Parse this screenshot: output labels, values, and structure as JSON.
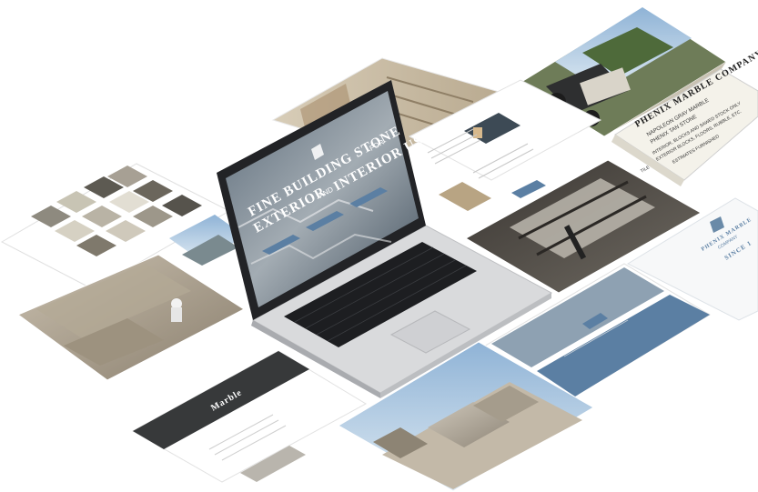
{
  "laptop": {
    "screen": {
      "headline_line1": "FINE BUILDING STONE",
      "headline_for": "FOR",
      "headline_line2": "EXTERIOR",
      "headline_and": "AND",
      "headline_line3": "INTERIOR USE"
    }
  },
  "cards": {
    "newspaper": {
      "title": "PHENIX MARBLE COMPANY",
      "line1": "NAPOLEON GRAY MARBLE",
      "line2": "PHENIX TAN STONE",
      "line3": "INTERIOR, BLOCKS AND SAWED STOCK ONLY",
      "line4": "EXTERIOR BLOCKS, FLOORS, RUBBLE, ETC.",
      "line5": "ESTIMATES FURNISHED",
      "line6": "TILE"
    },
    "logo_card": {
      "brand_line1": "PHENIX MARBLE",
      "brand_line2": "COMPANY",
      "tagline": "SINCE 1"
    },
    "marble_page": {
      "title": "Marble"
    }
  },
  "colors": {
    "accent_blue": "#5b7fa3",
    "stone_gray": "#b9b5ad",
    "laptop_silver": "#d9dadc",
    "keyboard_black": "#1d1e21"
  }
}
